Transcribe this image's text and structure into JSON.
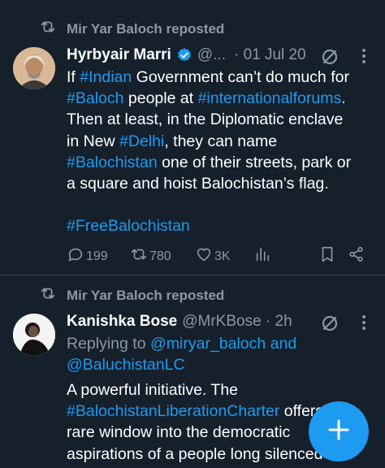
{
  "post1": {
    "repost_label": "Mir Yar Baloch reposted",
    "author_name": "Hyrbyair Marri",
    "handle": "@...",
    "date": "· 01 Jul 20",
    "body": [
      [
        {
          "t": "If "
        },
        {
          "t": "#Indian",
          "link": true
        },
        {
          "t": " Government can’t do much for"
        }
      ],
      [
        {
          "t": "#Baloch",
          "link": true
        },
        {
          "t": " people at "
        },
        {
          "t": "#internationalforums",
          "link": true
        },
        {
          "t": "."
        }
      ],
      [
        {
          "t": "Then at least, in the Diplomatic enclave"
        }
      ],
      [
        {
          "t": "in New "
        },
        {
          "t": "#Delhi",
          "link": true
        },
        {
          "t": ", they can name"
        }
      ],
      [
        {
          "t": "#Balochistan",
          "link": true
        },
        {
          "t": " one of their streets, park or"
        }
      ],
      [
        {
          "t": "a square and hoist Balochistan’s flag."
        }
      ],
      [
        {
          "t": " "
        }
      ],
      [
        {
          "t": "#FreeBalochistan",
          "link": true
        }
      ]
    ],
    "replies": "199",
    "reposts": "780",
    "likes": "3K"
  },
  "post2": {
    "repost_label": "Mir Yar Baloch reposted",
    "author_name": "Kanishka Bose",
    "handle": "@MrKBose · 2h",
    "replying_prefix": "Replying to",
    "replying_user1": "@miryar_baloch",
    "replying_and": "and",
    "replying_user2": "@BaluchistanLC",
    "body": [
      [
        {
          "t": "A powerful initiative. The"
        }
      ],
      [
        {
          "t": "#BalochistanLiberationCharter",
          "link": true
        },
        {
          "t": " offers a"
        }
      ],
      [
        {
          "t": "rare window into the democratic"
        }
      ],
      [
        {
          "t": "aspirations of a people long silenced"
        }
      ]
    ]
  },
  "colors": {
    "background": "#15202b",
    "accent": "#1d9bf0",
    "muted": "#8b98a5"
  },
  "fab_icon": "plus-icon"
}
